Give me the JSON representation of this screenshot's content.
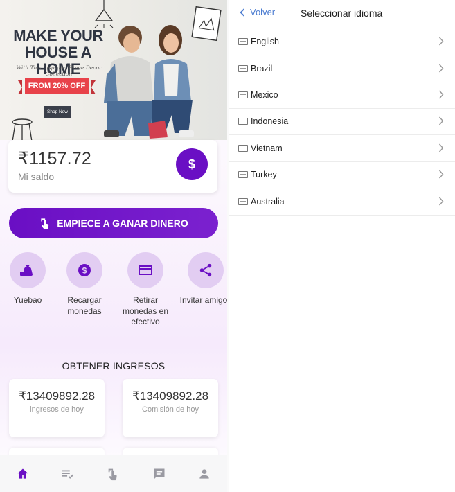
{
  "banner": {
    "headline": "MAKE YOUR HOUSE A HOME",
    "subline": "With This Inspiring Home Decor Collection",
    "discount": "FROM 20% OFF",
    "cta": "Shop Now"
  },
  "balance": {
    "amount": "₹1157.72",
    "label": "Mi saldo",
    "icon": "dollar-icon"
  },
  "earn_button": {
    "label": "EMPIECE A GANAR DINERO",
    "icon": "tap-hand-icon"
  },
  "actions": [
    {
      "label": "Yuebao",
      "icon": "money-bag-icon"
    },
    {
      "label": "Recargar monedas",
      "icon": "coin-icon"
    },
    {
      "label": "Retirar monedas en efectivo",
      "icon": "card-icon"
    },
    {
      "label": "Invitar amigos",
      "icon": "share-icon"
    }
  ],
  "income": {
    "title": "OBTENER INGRESOS",
    "cards": [
      {
        "value": "₹13409892.28",
        "label": "ingresos de hoy"
      },
      {
        "value": "₹13409892.28",
        "label": "Comisión de hoy"
      }
    ]
  },
  "bottom_nav": [
    {
      "icon": "home-icon",
      "active": true
    },
    {
      "icon": "task-list-icon",
      "active": false
    },
    {
      "icon": "tap-hand-icon",
      "active": false
    },
    {
      "icon": "chat-icon",
      "active": false
    },
    {
      "icon": "person-icon",
      "active": false
    }
  ],
  "language_screen": {
    "back_label": "Volver",
    "title": "Seleccionar idioma",
    "languages": [
      "English",
      "Brazil",
      "Mexico",
      "Indonesia",
      "Vietnam",
      "Turkey",
      "Australia"
    ]
  },
  "colors": {
    "primary": "#6a0fc4",
    "action_circle": "#e2cdf2",
    "link": "#4a7bd0"
  }
}
